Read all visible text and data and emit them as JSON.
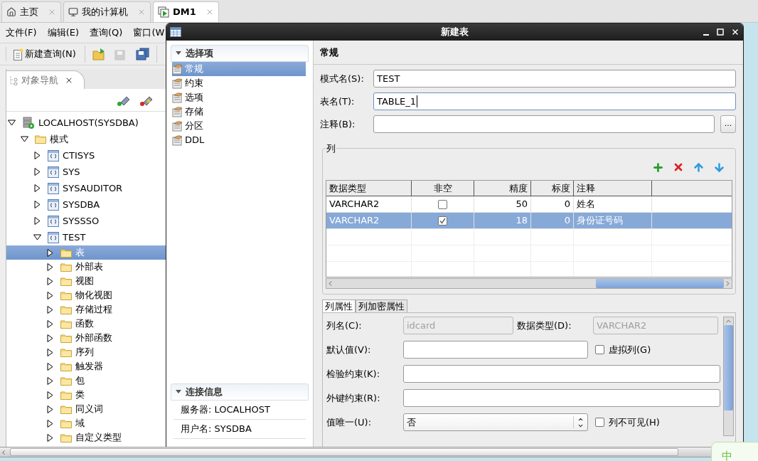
{
  "main_tabs": [
    {
      "label": "主页",
      "kind": "home",
      "selected": false
    },
    {
      "label": "我的计算机",
      "kind": "computer",
      "selected": false
    },
    {
      "label": "DM1",
      "kind": "database",
      "selected": true
    }
  ],
  "menu": [
    "文件(F)",
    "编辑(E)",
    "查询(Q)",
    "窗口(W"
  ],
  "toolbar": {
    "new_query": "新建查询(N)",
    "buttons": [
      {
        "kind": "open",
        "disabled": false
      },
      {
        "kind": "save",
        "disabled": true
      },
      {
        "kind": "save_all",
        "disabled": false
      }
    ]
  },
  "navigator": {
    "title": "对象导航"
  },
  "tree": [
    {
      "label": "LOCALHOST(SYSDBA)",
      "kind": "server",
      "expanded": true,
      "selected": false,
      "children": [
        {
          "label": "模式",
          "kind": "folder",
          "expanded": true,
          "selected": false,
          "children": [
            {
              "label": "CTISYS",
              "kind": "schema",
              "expanded": false,
              "selected": false
            },
            {
              "label": "SYS",
              "kind": "schema",
              "expanded": false,
              "selected": false
            },
            {
              "label": "SYSAUDITOR",
              "kind": "schema",
              "expanded": false,
              "selected": false
            },
            {
              "label": "SYSDBA",
              "kind": "schema",
              "expanded": false,
              "selected": false
            },
            {
              "label": "SYSSSO",
              "kind": "schema",
              "expanded": false,
              "selected": false
            },
            {
              "label": "TEST",
              "kind": "schema",
              "expanded": true,
              "selected": false,
              "children": [
                {
                  "label": "表",
                  "kind": "folder",
                  "expanded": false,
                  "selected": true
                },
                {
                  "label": "外部表",
                  "kind": "folder",
                  "expanded": false,
                  "selected": false
                },
                {
                  "label": "视图",
                  "kind": "folder",
                  "expanded": false,
                  "selected": false
                },
                {
                  "label": "物化视图",
                  "kind": "folder",
                  "expanded": false,
                  "selected": false
                },
                {
                  "label": "存储过程",
                  "kind": "folder",
                  "expanded": false,
                  "selected": false
                },
                {
                  "label": "函数",
                  "kind": "folder",
                  "expanded": false,
                  "selected": false
                },
                {
                  "label": "外部函数",
                  "kind": "folder",
                  "expanded": false,
                  "selected": false
                },
                {
                  "label": "序列",
                  "kind": "folder",
                  "expanded": false,
                  "selected": false
                },
                {
                  "label": "触发器",
                  "kind": "folder",
                  "expanded": false,
                  "selected": false
                },
                {
                  "label": "包",
                  "kind": "folder",
                  "expanded": false,
                  "selected": false
                },
                {
                  "label": "类",
                  "kind": "folder",
                  "expanded": false,
                  "selected": false
                },
                {
                  "label": "同义词",
                  "kind": "folder",
                  "expanded": false,
                  "selected": false
                },
                {
                  "label": "域",
                  "kind": "folder",
                  "expanded": false,
                  "selected": false
                },
                {
                  "label": "自定义类型",
                  "kind": "folder",
                  "expanded": false,
                  "selected": false
                }
              ]
            }
          ]
        }
      ]
    }
  ],
  "dialog": {
    "title": "新建表",
    "sidebar": {
      "header": "选择项",
      "items": [
        {
          "label": "常规",
          "selected": true
        },
        {
          "label": "约束",
          "selected": false
        },
        {
          "label": "选项",
          "selected": false
        },
        {
          "label": "存储",
          "selected": false
        },
        {
          "label": "分区",
          "selected": false
        },
        {
          "label": "DDL",
          "selected": false
        }
      ]
    },
    "connection": {
      "header": "连接信息",
      "rows": [
        "服务器: LOCALHOST",
        "用户名: SYSDBA"
      ]
    },
    "section_title": "常规",
    "fields": [
      {
        "label": "模式名(S):",
        "value": "TEST",
        "focused": false
      },
      {
        "label": "表名(T):",
        "value": "TABLE_1",
        "focused": true
      },
      {
        "label": "注释(B):",
        "button": "..."
      }
    ],
    "columns_group": {
      "title": "列",
      "table": {
        "columns": [
          "数据类型",
          "非空",
          "精度",
          "标度",
          "注释"
        ],
        "rows": [
          {
            "data_type": "VARCHAR2",
            "not_null": false,
            "precision": "50",
            "scale": "0",
            "comment": "姓名",
            "selected": false
          },
          {
            "data_type": "VARCHAR2",
            "not_null": true,
            "precision": "18",
            "scale": "0",
            "comment": "身份证号码",
            "selected": true
          }
        ]
      }
    },
    "property_tabs": [
      {
        "label": "列属性",
        "selected": true
      },
      {
        "label": "列加密属性",
        "selected": false
      }
    ],
    "column_properties": {
      "column_name": {
        "label": "列名(C):",
        "value": "idcard",
        "disabled": true
      },
      "data_type": {
        "label": "数据类型(D):",
        "value": "VARCHAR2",
        "disabled": true
      },
      "default_value": {
        "label": "默认值(V):"
      },
      "virtual_column": {
        "label": "虚拟列(G)",
        "checked": false
      },
      "check_constraint": {
        "label": "检验约束(K):"
      },
      "foreign_key": {
        "label": "外键约束(R):"
      },
      "unique": {
        "label": "值唯一(U):",
        "value": "否"
      },
      "invisible": {
        "label": "列不可见(H)",
        "checked": false
      }
    }
  },
  "ime": {
    "label": "中"
  }
}
